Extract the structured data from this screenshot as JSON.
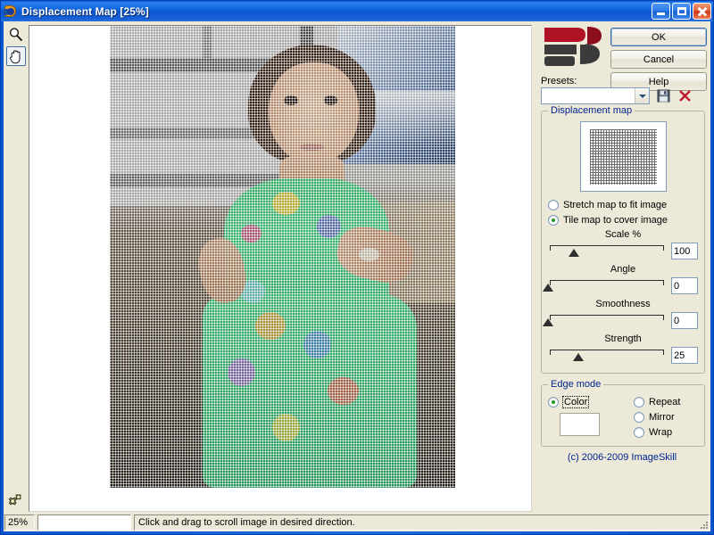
{
  "window": {
    "title": "Displacement Map [25%]",
    "icon": "app-icon",
    "buttons": {
      "minimize": "minimize",
      "maximize": "maximize",
      "close": "close"
    }
  },
  "toolbar": {
    "tools": [
      {
        "name": "zoom-tool",
        "icon": "magnifier-icon",
        "selected": false
      },
      {
        "name": "pan-tool",
        "icon": "hand-icon",
        "selected": true
      }
    ],
    "settings": {
      "name": "settings-tool",
      "icon": "gears-icon"
    }
  },
  "actions": {
    "ok": "OK",
    "cancel": "Cancel",
    "help": "Help"
  },
  "presets": {
    "label": "Presets:",
    "value": "",
    "placeholder": "",
    "save_icon": "floppy-save-icon",
    "delete_icon": "red-x-delete-icon"
  },
  "displacement_map": {
    "legend": "Displacement map",
    "thumbnail": "grid-pattern-map",
    "mode_options": [
      {
        "label": "Stretch map to fit image",
        "selected": false
      },
      {
        "label": "Tile map to cover image",
        "selected": true
      }
    ],
    "sliders": [
      {
        "name": "scale",
        "label": "Scale %",
        "value": "100",
        "percent": 22
      },
      {
        "name": "angle",
        "label": "Angle",
        "value": "0",
        "percent": 0
      },
      {
        "name": "smoothness",
        "label": "Smoothness",
        "value": "0",
        "percent": 0
      },
      {
        "name": "strength",
        "label": "Strength",
        "value": "25",
        "percent": 25
      }
    ]
  },
  "edge_mode": {
    "legend": "Edge mode",
    "options": [
      {
        "label": "Color",
        "selected": true,
        "focused": true
      },
      {
        "label": "Repeat",
        "selected": false,
        "focused": false
      },
      {
        "label": "Mirror",
        "selected": false,
        "focused": false
      },
      {
        "label": "Wrap",
        "selected": false,
        "focused": false
      }
    ],
    "color_value": "#ffffff"
  },
  "copyright": "(c) 2006-2009 ImageSkill",
  "status_bar": {
    "zoom": "25%",
    "progress": "",
    "hint": "Click and drag to scroll image in desired direction."
  },
  "colors": {
    "title_blue": "#1468e2",
    "panel_bg": "#ece9d8",
    "legend_blue": "#00248f",
    "accent_red": "#c0182c"
  }
}
